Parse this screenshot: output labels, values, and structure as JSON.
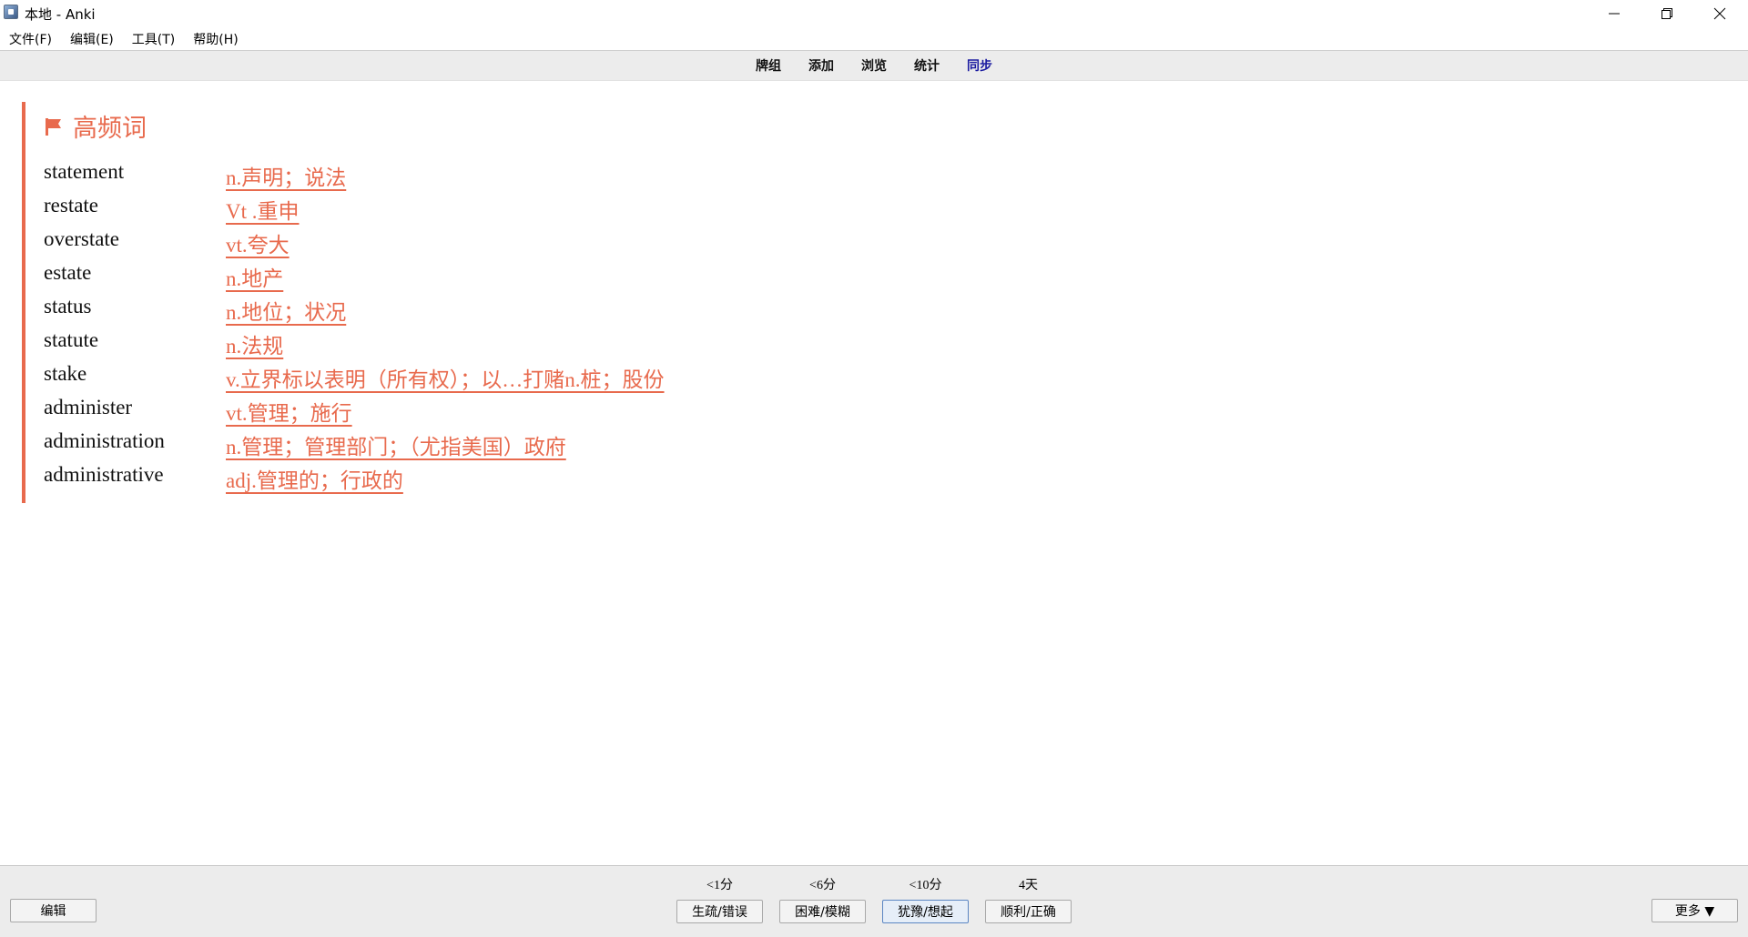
{
  "window": {
    "title": "本地 - Anki"
  },
  "menu": {
    "items": [
      "文件(F)",
      "编辑(E)",
      "工具(T)",
      "帮助(H)"
    ]
  },
  "toolbar": {
    "items": [
      "牌组",
      "添加",
      "浏览",
      "统计",
      "同步"
    ]
  },
  "card": {
    "deck_title": "高频词",
    "accent_color": "#e86a4d",
    "rows": [
      {
        "word": "statement",
        "meaning": "n.声明；说法"
      },
      {
        "word": "restate",
        "meaning": "Vt .重申"
      },
      {
        "word": "overstate",
        "meaning": "vt.夸大"
      },
      {
        "word": "estate",
        "meaning": "n.地产"
      },
      {
        "word": "status",
        "meaning": "n.地位；状况"
      },
      {
        "word": "statute",
        "meaning": "n.法规"
      },
      {
        "word": "stake",
        "meaning": "v.立界标以表明（所有权）；以…打赌n.桩；股份"
      },
      {
        "word": "administer",
        "meaning": "vt.管理；施行"
      },
      {
        "word": "administration",
        "meaning": "n.管理；管理部门；（尤指美国）政府"
      },
      {
        "word": "administrative",
        "meaning": "adj.管理的；行政的"
      }
    ]
  },
  "bottom": {
    "edit_label": "编辑",
    "more_label": "更多 ▼",
    "answers": [
      {
        "interval": "<1分",
        "label": "生疏/错误"
      },
      {
        "interval": "<6分",
        "label": "困难/模糊"
      },
      {
        "interval": "<10分",
        "label": "犹豫/想起"
      },
      {
        "interval": "4天",
        "label": "顺利/正确"
      }
    ]
  }
}
